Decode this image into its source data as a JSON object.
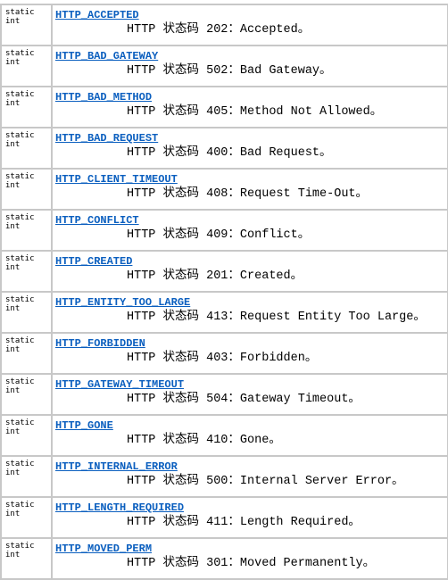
{
  "type_label": "static int",
  "fields": [
    {
      "name": "HTTP_ACCEPTED",
      "desc": "HTTP 状态码 202：Accepted。"
    },
    {
      "name": "HTTP_BAD_GATEWAY",
      "desc": "HTTP 状态码 502：Bad Gateway。"
    },
    {
      "name": "HTTP_BAD_METHOD",
      "desc": "HTTP 状态码 405：Method Not Allowed。"
    },
    {
      "name": "HTTP_BAD_REQUEST",
      "desc": "HTTP 状态码 400：Bad Request。"
    },
    {
      "name": "HTTP_CLIENT_TIMEOUT",
      "desc": "HTTP 状态码 408：Request Time-Out。"
    },
    {
      "name": "HTTP_CONFLICT",
      "desc": "HTTP 状态码 409：Conflict。"
    },
    {
      "name": "HTTP_CREATED",
      "desc": "HTTP 状态码 201：Created。"
    },
    {
      "name": "HTTP_ENTITY_TOO_LARGE",
      "desc": "HTTP 状态码 413：Request Entity Too Large。"
    },
    {
      "name": "HTTP_FORBIDDEN",
      "desc": "HTTP 状态码 403：Forbidden。"
    },
    {
      "name": "HTTP_GATEWAY_TIMEOUT",
      "desc": "HTTP 状态码 504：Gateway Timeout。"
    },
    {
      "name": "HTTP_GONE",
      "desc": "HTTP 状态码 410：Gone。"
    },
    {
      "name": "HTTP_INTERNAL_ERROR",
      "desc": "HTTP 状态码 500：Internal Server Error。"
    },
    {
      "name": "HTTP_LENGTH_REQUIRED",
      "desc": "HTTP 状态码 411：Length Required。"
    },
    {
      "name": "HTTP_MOVED_PERM",
      "desc": "HTTP 状态码 301：Moved Permanently。"
    }
  ]
}
